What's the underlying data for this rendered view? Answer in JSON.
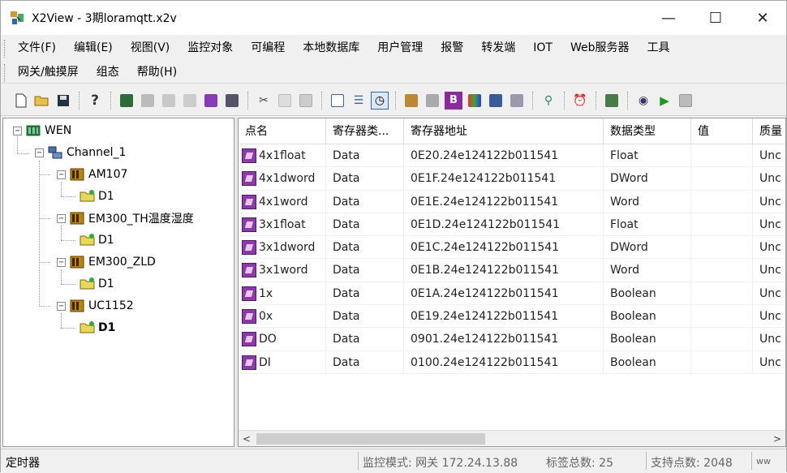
{
  "window": {
    "title": "X2View - 3期loramqtt.x2v",
    "minimize": "—",
    "maximize": "☐",
    "close": "✕"
  },
  "menu": {
    "row1": [
      "文件(F)",
      "编辑(E)",
      "视图(V)",
      "监控对象",
      "可编程",
      "本地数据库",
      "用户管理",
      "报警",
      "转发端",
      "IOT",
      "Web服务器",
      "工具"
    ],
    "row2": [
      "网关/触摸屏",
      "组态",
      "帮助(H)"
    ]
  },
  "tree": {
    "root": "WEN",
    "channel": "Channel_1",
    "devices": [
      {
        "name": "AM107",
        "child": "D1"
      },
      {
        "name": "EM300_TH温度湿度",
        "child": "D1"
      },
      {
        "name": "EM300_ZLD",
        "child": "D1"
      },
      {
        "name": "UC1152",
        "child": "D1"
      }
    ]
  },
  "table": {
    "columns": [
      "点名",
      "寄存器类...",
      "寄存器地址",
      "数据类型",
      "值",
      "质量"
    ],
    "rows": [
      [
        "4x1float",
        "Data",
        "0E20.24e124122b011541",
        "Float",
        "",
        "Unc"
      ],
      [
        "4x1dword",
        "Data",
        "0E1F.24e124122b011541",
        "DWord",
        "",
        "Unc"
      ],
      [
        "4x1word",
        "Data",
        "0E1E.24e124122b011541",
        "Word",
        "",
        "Unc"
      ],
      [
        "3x1float",
        "Data",
        "0E1D.24e124122b011541",
        "Float",
        "",
        "Unc"
      ],
      [
        "3x1dword",
        "Data",
        "0E1C.24e124122b011541",
        "DWord",
        "",
        "Unc"
      ],
      [
        "3x1word",
        "Data",
        "0E1B.24e124122b011541",
        "Word",
        "",
        "Unc"
      ],
      [
        "1x",
        "Data",
        "0E1A.24e124122b011541",
        "Boolean",
        "",
        "Unc"
      ],
      [
        "0x",
        "Data",
        "0E19.24e124122b011541",
        "Boolean",
        "",
        "Unc"
      ],
      [
        "DO",
        "Data",
        "0901.24e124122b011541",
        "Boolean",
        "",
        "Unc"
      ],
      [
        "DI",
        "Data",
        "0100.24e124122b011541",
        "Boolean",
        "",
        "Unc"
      ]
    ]
  },
  "status": {
    "left": "定时器",
    "monitor": "监控模式: 网关 172.24.13.88",
    "tags_total": "标签总数: 25",
    "points": "支持点数: 2048",
    "extra": "ww"
  },
  "colors": {
    "tag_icon": "#8c3aa8",
    "play": "#1a9c1a",
    "selected_text": "#000000"
  }
}
